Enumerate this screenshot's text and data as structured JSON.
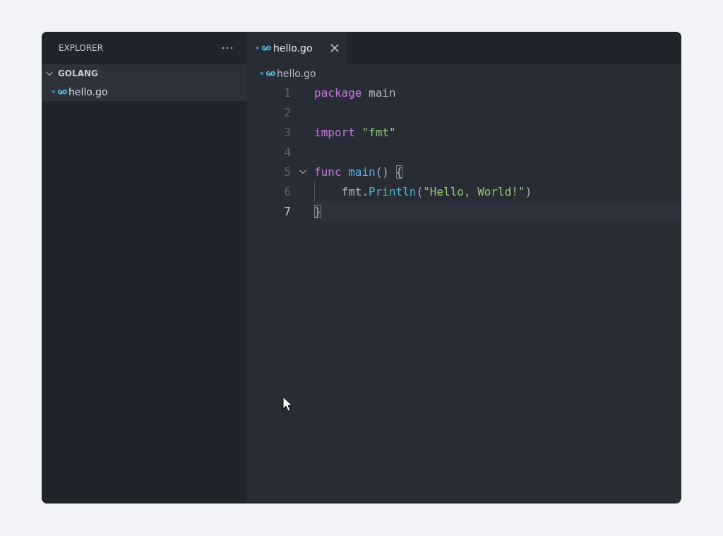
{
  "sidebar": {
    "title": "EXPLORER",
    "folder": {
      "name": "GOLANG",
      "expanded": true,
      "children": [
        {
          "name": "hello.go",
          "selected": true
        }
      ]
    }
  },
  "tabs": [
    {
      "label": "hello.go",
      "selected": true
    }
  ],
  "breadcrumb": "hello.go",
  "editor": {
    "lines": [
      {
        "number": "1",
        "current": false,
        "foldable": false,
        "indent_guide": false,
        "tokens": [
          {
            "text": "package",
            "kind": "keyword"
          },
          {
            "text": " main",
            "kind": "plain"
          }
        ]
      },
      {
        "number": "2",
        "current": false,
        "foldable": false,
        "indent_guide": false
      },
      {
        "number": "3",
        "current": false,
        "foldable": false,
        "indent_guide": false,
        "tokens": [
          {
            "text": "import",
            "kind": "keyword"
          },
          {
            "text": " \"fmt\"",
            "kind": "string"
          }
        ]
      },
      {
        "number": "4",
        "current": false,
        "foldable": false,
        "indent_guide": false
      },
      {
        "number": "5",
        "current": false,
        "foldable": true,
        "indent_guide": false,
        "tokens": [
          {
            "text": "func",
            "kind": "keyword"
          },
          {
            "text": " main",
            "kind": "function"
          },
          {
            "text": "() ",
            "kind": "plain"
          },
          {
            "text": "{",
            "kind": "bracket-match"
          }
        ]
      },
      {
        "number": "6",
        "current": false,
        "foldable": false,
        "indent_guide": true,
        "tokens": [
          {
            "text": "    fmt.",
            "kind": "plain"
          },
          {
            "text": "Println",
            "kind": "method"
          },
          {
            "text": "(",
            "kind": "plain"
          },
          {
            "text": "\"Hello, World!\"",
            "kind": "string"
          },
          {
            "text": ")",
            "kind": "plain"
          }
        ]
      },
      {
        "number": "7",
        "current": true,
        "foldable": false,
        "indent_guide": false,
        "tokens": [
          {
            "text": "}",
            "kind": "bracket-match"
          }
        ]
      }
    ]
  }
}
